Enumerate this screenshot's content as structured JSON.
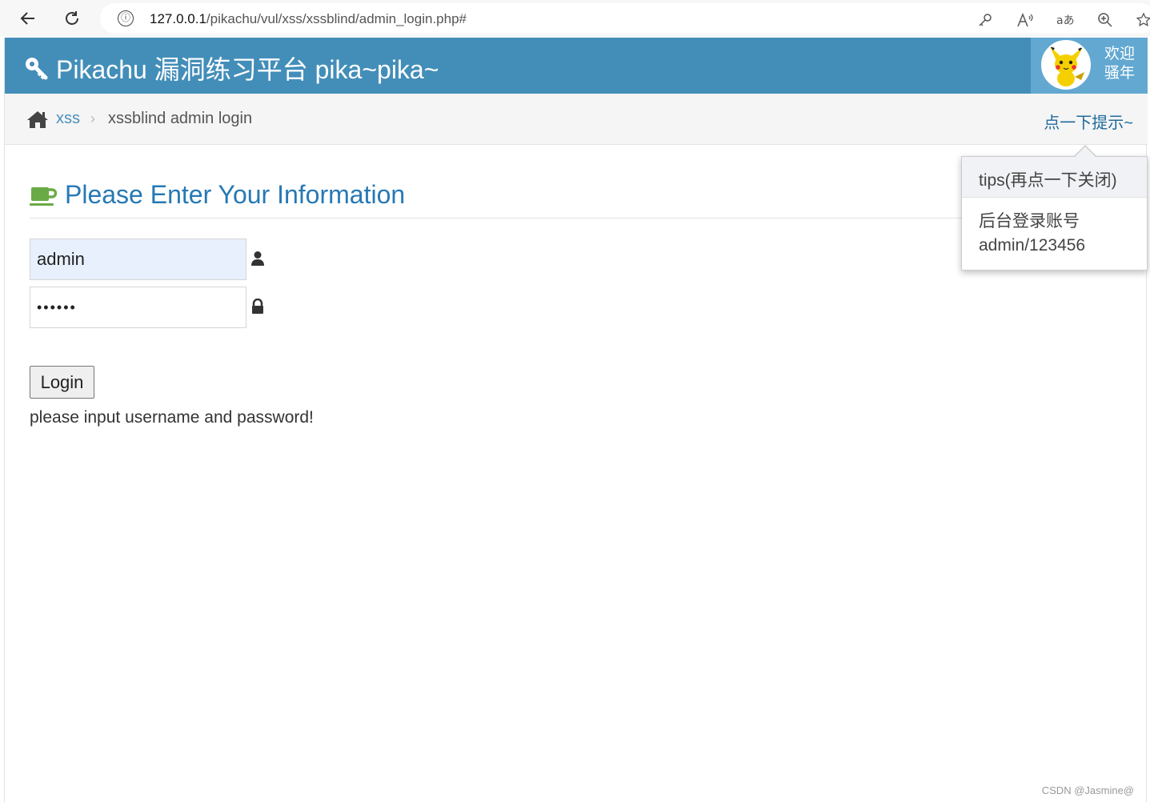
{
  "browser": {
    "url_host": "127.0.0.1",
    "url_path": "/pikachu/vul/xss/xssblind/admin_login.php#",
    "info_icon": "ⓘ"
  },
  "header": {
    "brand_title": "Pikachu 漏洞练习平台 pika~pika~",
    "welcome_line1": "欢迎",
    "welcome_line2": "骚年",
    "accent_color": "#438eb9"
  },
  "breadcrumbs": {
    "link_label": "xss",
    "separator": "›",
    "active_label": "xssblind admin login",
    "hint_label": "点一下提示~"
  },
  "main": {
    "title": "Please Enter Your Information",
    "username_value": "admin",
    "password_value": "••••••",
    "login_label": "Login",
    "status_message": "please input username and password!"
  },
  "popover": {
    "title": "tips(再点一下关闭)",
    "line1": "后台登录账号",
    "line2": "admin/123456"
  },
  "watermark": "CSDN @Jasmine@"
}
